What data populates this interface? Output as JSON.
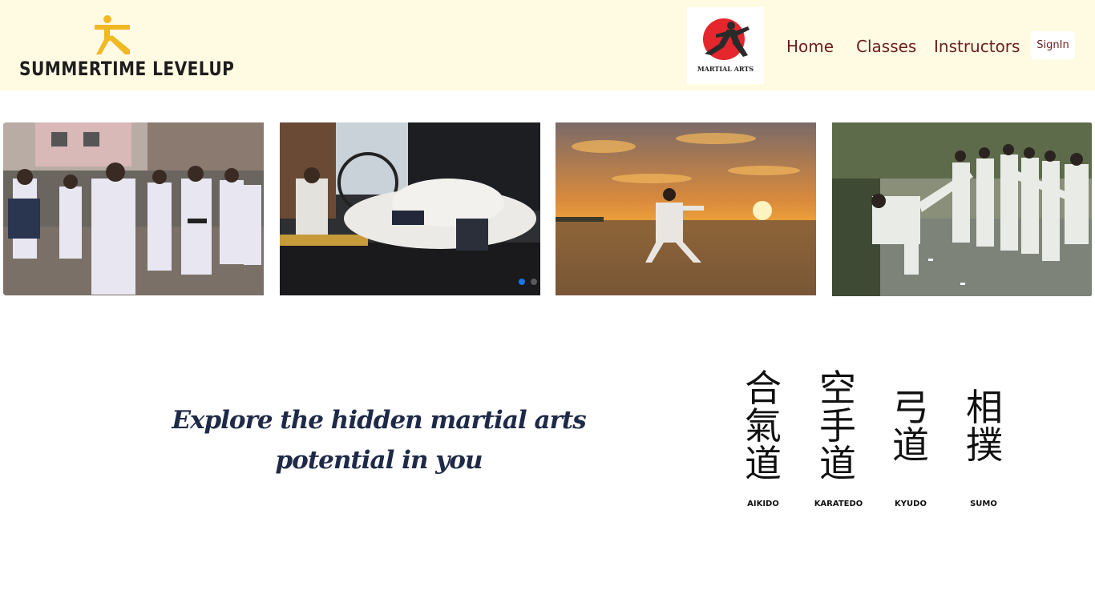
{
  "header": {
    "brand_name": "SUMMERTIME LEVELUP",
    "partner_logo_text": "MARTIAL ARTS",
    "nav": [
      {
        "label": "Home"
      },
      {
        "label": "Classes"
      },
      {
        "label": "Instructors"
      }
    ],
    "signin_label": "SignIn",
    "colors": {
      "background": "#fffbe3",
      "nav_text": "#6d1d1d",
      "brand_figure": "#f0b823",
      "logo_sun": "#e5262c"
    }
  },
  "carousel": {
    "slides": [
      {
        "alt": "kids-karate-class-icon"
      },
      {
        "alt": "jiu-jitsu-grappling-icon"
      },
      {
        "alt": "karate-sunset-beach-icon"
      },
      {
        "alt": "group-high-kick-icon"
      }
    ],
    "active_index": 0,
    "indicator_count": 3,
    "colors": {
      "active_dot": "#1a73e8",
      "inactive_dot": "#cccccc"
    }
  },
  "tagline": {
    "line1": "Explore the hidden martial arts",
    "line2": "potential in you"
  },
  "disciplines": [
    {
      "chars": "合氣道",
      "label": "AIKIDO"
    },
    {
      "chars": "空手道",
      "label": "KARATEDO"
    },
    {
      "chars": "弓道",
      "label": "KYUDO"
    },
    {
      "chars": "相撲",
      "label": "SUMO"
    }
  ]
}
